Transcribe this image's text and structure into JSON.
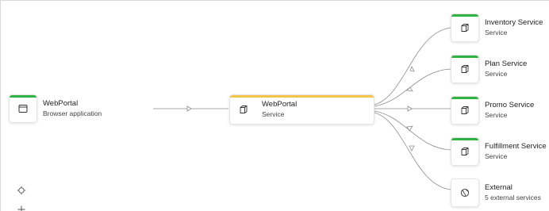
{
  "source_node": {
    "title": "WebPortal",
    "subtitle": "Browser application",
    "icon": "browser-window-icon"
  },
  "center_node": {
    "title": "WebPortal",
    "subtitle": "Service",
    "icon": "cube-icon",
    "accent_color": "#f5c54a"
  },
  "target_nodes": [
    {
      "title": "Inventory Service",
      "subtitle": "Service",
      "icon": "cube-icon"
    },
    {
      "title": "Plan Service",
      "subtitle": "Service",
      "icon": "cube-icon"
    },
    {
      "title": "Promo Service",
      "subtitle": "Service",
      "icon": "cube-icon"
    },
    {
      "title": "Fulfillment Service",
      "subtitle": "Service",
      "icon": "cube-icon"
    },
    {
      "title": "External",
      "subtitle": "5 external services",
      "icon": "globe-icon"
    }
  ],
  "colors": {
    "service_accent": "#2fb344",
    "edge": "#8c8c8c"
  },
  "controls": [
    {
      "name": "fit-view",
      "icon": "crosshair-icon"
    },
    {
      "name": "zoom-in",
      "icon": "plus-icon"
    }
  ]
}
